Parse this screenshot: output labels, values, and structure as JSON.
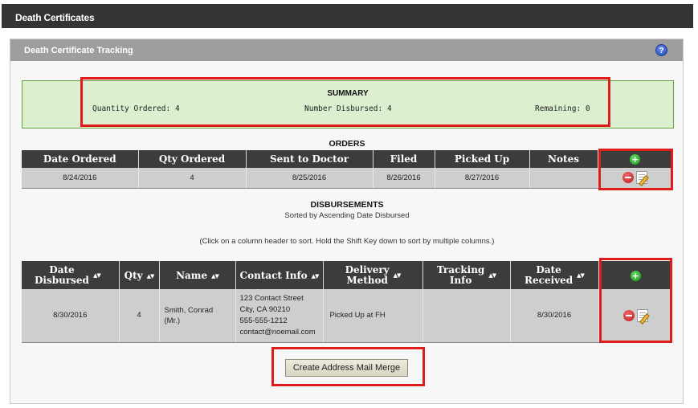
{
  "app": {
    "title": "Death Certificates"
  },
  "panel": {
    "title": "Death Certificate Tracking",
    "help_icon": "help-icon",
    "help_glyph": "?"
  },
  "summary": {
    "title": "SUMMARY",
    "quantity_ordered": "Quantity Ordered: 4",
    "number_disbursed": "Number Disbursed: 4",
    "remaining": "Remaining: 0"
  },
  "orders": {
    "title": "ORDERS",
    "headers": [
      "Date Ordered",
      "Qty Ordered",
      "Sent to Doctor",
      "Filed",
      "Picked Up",
      "Notes"
    ],
    "rows": [
      {
        "date_ordered": "8/24/2016",
        "qty": "4",
        "sent_to_doctor": "8/25/2016",
        "filed": "8/26/2016",
        "picked_up": "8/27/2016",
        "notes": ""
      }
    ]
  },
  "disbursements": {
    "title": "DISBURSEMENTS",
    "subtitle": "Sorted by Ascending Date Disbursed",
    "sort_hint": "(Click on a column header to sort. Hold the Shift Key down to sort by multiple columns.)",
    "headers": {
      "date_disbursed": [
        "Date",
        "Disbursed"
      ],
      "qty": "Qty",
      "name": "Name",
      "contact_info": "Contact Info",
      "delivery_method": [
        "Delivery",
        "Method"
      ],
      "tracking_info": [
        "Tracking",
        "Info"
      ],
      "date_received": [
        "Date",
        "Received"
      ]
    },
    "sort_arrows": "▲▼",
    "rows": [
      {
        "date_disbursed": "8/30/2016",
        "qty": "4",
        "name_line1": "Smith, Conrad",
        "name_line2": "(Mr.)",
        "contact_lines": [
          "123 Contact Street",
          "City, CA 90210",
          "555-555-1212",
          "contact@noemail.com"
        ],
        "delivery_method": "Picked Up at FH",
        "tracking_info": "",
        "date_received": "8/30/2016"
      }
    ]
  },
  "actions": {
    "add_glyph": "+",
    "merge_button": "Create Address Mail Merge"
  },
  "colors": {
    "highlight": "#e01b1b",
    "summary_bg": "#dcefcf",
    "header_bg": "#3c3c3c"
  }
}
